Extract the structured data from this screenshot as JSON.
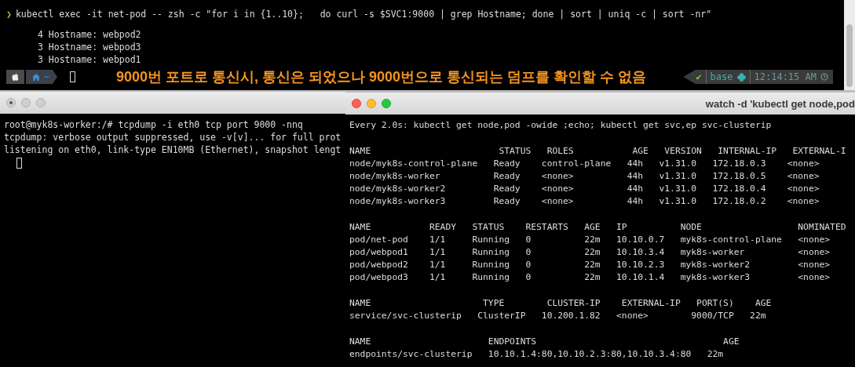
{
  "top_terminal": {
    "prompt": "❯",
    "command": "kubectl exec -it net-pod -- zsh -c \"for i in {1..10};   do curl -s $SVC1:9000 | grep Hostname; done | sort | uniq -c | sort -nr\"",
    "output": [
      "4 Hostname: webpod2",
      "3 Hostname: webpod3",
      "3 Hostname: webpod1"
    ],
    "status_bar": {
      "path": "~",
      "annotation": "9000번 포트로 통신시, 통신은 되었으나 9000번으로 통신되는 덤프를 확인할 수 없음",
      "check": "✔",
      "env": "base",
      "time": "12:14:15 AM"
    }
  },
  "left_window": {
    "lines": [
      "root@myk8s-worker:/# tcpdump -i eth0 tcp port 9000 -nnq",
      "tcpdump: verbose output suppressed, use -v[v]... for full prot",
      "listening on eth0, link-type EN10MB (Ethernet), snapshot lengt"
    ]
  },
  "right_window": {
    "title": "watch -d 'kubectl get node,pod",
    "header": "Every 2.0s: kubectl get node,pod -owide ;echo; kubectl get svc,ep svc-clusterip",
    "blocks": [
      [
        "NAME                        STATUS   ROLES           AGE   VERSION   INTERNAL-IP   EXTERNAL-I",
        "node/myk8s-control-plane   Ready    control-plane   44h   v1.31.0   172.18.0.3    <none>",
        "node/myk8s-worker          Ready    <none>          44h   v1.31.0   172.18.0.5    <none>",
        "node/myk8s-worker2         Ready    <none>          44h   v1.31.0   172.18.0.4    <none>",
        "node/myk8s-worker3         Ready    <none>          44h   v1.31.0   172.18.0.2    <none>"
      ],
      [
        "NAME           READY   STATUS    RESTARTS   AGE   IP          NODE                  NOMINATED",
        "pod/net-pod    1/1     Running   0          22m   10.10.0.7   myk8s-control-plane   <none>",
        "pod/webpod1    1/1     Running   0          22m   10.10.3.4   myk8s-worker          <none>",
        "pod/webpod2    1/1     Running   0          22m   10.10.2.3   myk8s-worker2         <none>",
        "pod/webpod3    1/1     Running   0          22m   10.10.1.4   myk8s-worker3         <none>"
      ],
      [
        "NAME                     TYPE        CLUSTER-IP    EXTERNAL-IP   PORT(S)    AGE",
        "service/svc-clusterip   ClusterIP   10.200.1.82   <none>        9000/TCP   22m"
      ],
      [
        "NAME                      ENDPOINTS                                   AGE",
        "endpoints/svc-clusterip   10.10.1.4:80,10.10.2.3:80,10.10.3.4:80   22m"
      ]
    ]
  }
}
